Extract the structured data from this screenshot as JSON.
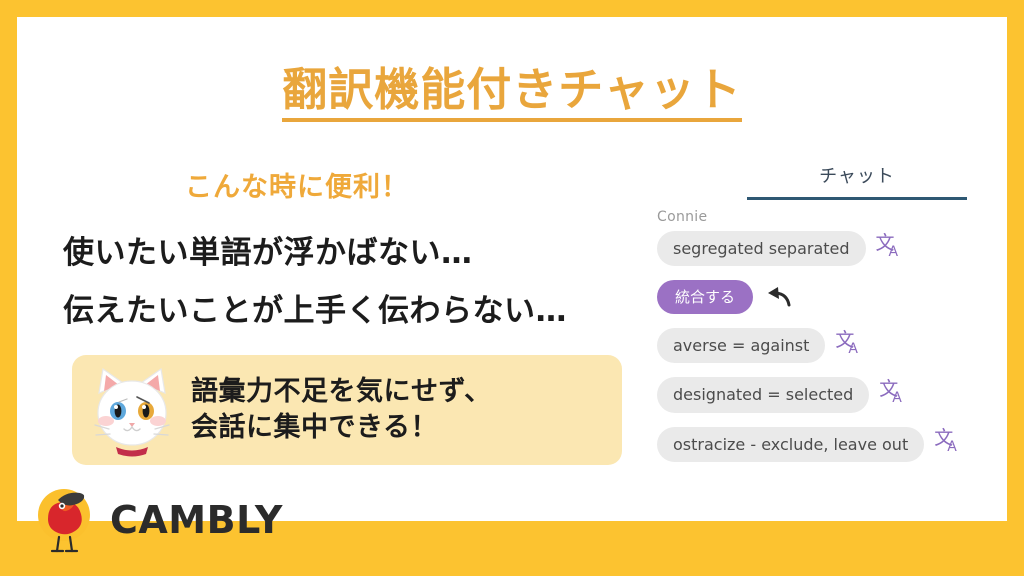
{
  "slide": {
    "title": "翻訳機能付きチャット",
    "subhead": "こんな時に便利！",
    "pain_points": [
      "使いたい単語が浮かばない…",
      "伝えたいことが上手く伝わらない…"
    ],
    "highlight": {
      "lines": [
        "語彙力不足を気にせず、",
        "会話に集中できる！"
      ],
      "mascot": "white-cat-mascot"
    },
    "colors": {
      "frame": "#FCC330",
      "title_orange": "#E9A63C",
      "subhead_orange": "#EFA93A",
      "highlight_bg": "#FBE7B2",
      "body_text": "#1C1C1C",
      "bubble_incoming": "#EAEAEA",
      "bubble_translated": "#9B71C4",
      "translate_icon": "#8B6BBE",
      "tab_underline": "#2E5873"
    }
  },
  "logo": {
    "wordmark": "CAMBLY",
    "icon": "cambly-bird-logo"
  },
  "chat": {
    "tab_label": "チャット",
    "sender": "Connie",
    "messages": [
      {
        "text": "segregated separated",
        "type": "incoming",
        "action_icon": "translate-icon"
      },
      {
        "text": "統合する",
        "type": "translated",
        "action_icon": "undo-icon"
      },
      {
        "text": "averse = against",
        "type": "incoming",
        "action_icon": "translate-icon"
      },
      {
        "text": "designated = selected",
        "type": "incoming",
        "action_icon": "translate-icon"
      },
      {
        "text": "ostracize - exclude, leave out",
        "type": "incoming",
        "action_icon": "translate-icon"
      }
    ],
    "translate_glyph_cjk": "文",
    "translate_glyph_latin": "A"
  }
}
